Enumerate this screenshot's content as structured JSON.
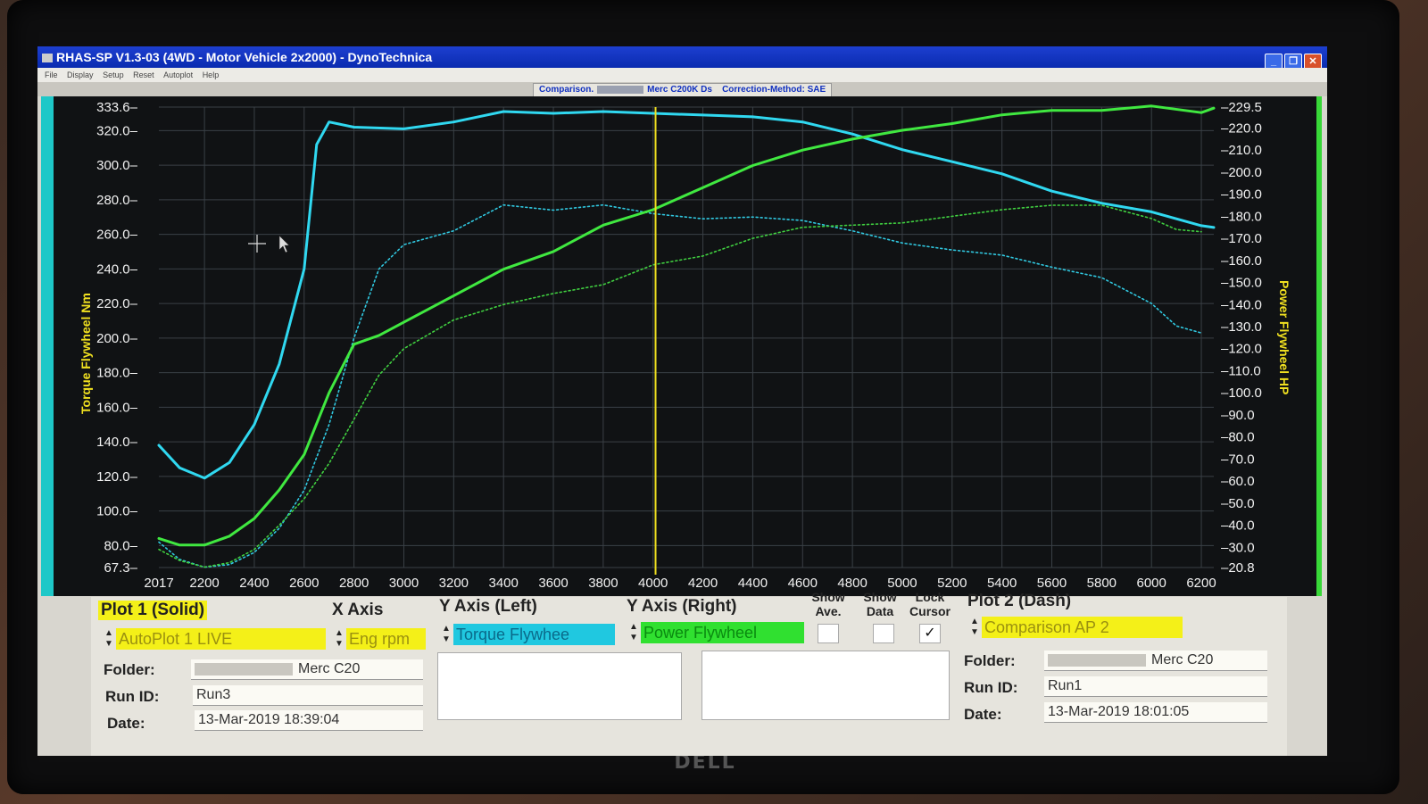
{
  "window": {
    "title": "RHAS-SP V1.3-03  (4WD - Motor Vehicle 2x2000) - DynoTechnica",
    "buttons": [
      "_",
      "❐",
      "✕"
    ]
  },
  "menu": [
    "File",
    "Display",
    "Setup",
    "Reset",
    "Autoplot",
    "Help"
  ],
  "info": {
    "comparison_label": "Comparison.",
    "vehicle": "Merc C200K Ds",
    "correction": "Correction-Method: SAE"
  },
  "axis_labels": {
    "left": "Torque Flywheel Nm",
    "right": "Power Flywheel HP"
  },
  "chart_data": {
    "type": "line",
    "xlabel": "",
    "x_ticks": [
      "2017",
      "2200",
      "2400",
      "2600",
      "2800",
      "3000",
      "3200",
      "3400",
      "3600",
      "3800",
      "4000",
      "4200",
      "4400",
      "4600",
      "4800",
      "5000",
      "5200",
      "5400",
      "5600",
      "5800",
      "6000",
      "6200"
    ],
    "xlim": [
      2017,
      6250
    ],
    "y_left": {
      "label": "Torque Flywheel Nm",
      "ticks": [
        "333.6",
        "320.0",
        "300.0",
        "280.0",
        "260.0",
        "240.0",
        "220.0",
        "200.0",
        "180.0",
        "160.0",
        "140.0",
        "120.0",
        "100.0",
        "80.0",
        "67.3"
      ],
      "range": [
        67.3,
        333.6
      ]
    },
    "y_right": {
      "label": "Power Flywheel HP",
      "ticks": [
        "229.5",
        "220.0",
        "210.0",
        "200.0",
        "190.0",
        "180.0",
        "170.0",
        "160.0",
        "150.0",
        "140.0",
        "130.0",
        "120.0",
        "110.0",
        "100.0",
        "90.0",
        "80.0",
        "70.0",
        "60.0",
        "50.0",
        "40.0",
        "30.0",
        "20.8"
      ],
      "range": [
        20.8,
        229.5
      ]
    },
    "cursor_x": 4010,
    "grid": true,
    "series": [
      {
        "name": "",
        "axis": "left",
        "style": "solid",
        "color": "#30d8f0",
        "x": [
          2017,
          2100,
          2200,
          2300,
          2400,
          2500,
          2600,
          2650,
          2700,
          2800,
          3000,
          3200,
          3400,
          3600,
          3800,
          4000,
          4200,
          4400,
          4600,
          4800,
          5000,
          5200,
          5400,
          5600,
          5800,
          6000,
          6200,
          6250
        ],
        "y": [
          138,
          125,
          119,
          128,
          150,
          185,
          240,
          312,
          325,
          322,
          321,
          325,
          331,
          330,
          331,
          330,
          329,
          328,
          325,
          318,
          309,
          302,
          295,
          285,
          278,
          273,
          265,
          264
        ]
      },
      {
        "name": "",
        "axis": "left",
        "style": "dotted",
        "color": "#30c8e0",
        "x": [
          2017,
          2100,
          2200,
          2300,
          2400,
          2500,
          2600,
          2700,
          2800,
          2900,
          3000,
          3200,
          3400,
          3600,
          3800,
          4000,
          4200,
          4400,
          4600,
          4800,
          5000,
          5200,
          5400,
          5600,
          5800,
          6000,
          6100,
          6200
        ],
        "y": [
          82,
          72,
          67.5,
          69,
          76,
          90,
          112,
          150,
          200,
          240,
          254,
          262,
          277,
          274,
          277,
          272,
          269,
          270,
          268,
          262,
          255,
          251,
          248,
          241,
          235,
          220,
          207,
          203
        ]
      },
      {
        "name": "",
        "axis": "right",
        "style": "solid",
        "color": "#40e840",
        "x": [
          2017,
          2100,
          2200,
          2300,
          2400,
          2500,
          2600,
          2700,
          2800,
          2900,
          3000,
          3200,
          3400,
          3600,
          3800,
          4000,
          4200,
          4400,
          4600,
          4800,
          5000,
          5200,
          5400,
          5600,
          5800,
          6000,
          6200,
          6250
        ],
        "y": [
          34,
          31,
          31,
          35,
          43,
          56,
          72,
          100,
          122,
          126,
          132,
          144,
          156,
          164,
          176,
          183,
          193,
          203,
          210,
          215,
          219,
          222,
          226,
          228,
          228,
          230,
          227,
          229
        ]
      },
      {
        "name": "",
        "axis": "right",
        "style": "dotted",
        "color": "#40d040",
        "x": [
          2017,
          2100,
          2200,
          2300,
          2400,
          2500,
          2600,
          2700,
          2800,
          2900,
          3000,
          3200,
          3400,
          3600,
          3800,
          4000,
          4200,
          4400,
          4600,
          4800,
          5000,
          5200,
          5400,
          5600,
          5800,
          6000,
          6100,
          6200
        ],
        "y": [
          29,
          24,
          21,
          23,
          29,
          40,
          52,
          68,
          88,
          108,
          120,
          133,
          140,
          145,
          149,
          158,
          162,
          170,
          175,
          176,
          177,
          180,
          183,
          185,
          185,
          179,
          174,
          173
        ]
      }
    ]
  },
  "panel": {
    "plot1_header": "Plot 1 (Solid)",
    "plot1_select": "AutoPlot 1 LIVE",
    "xaxis_header": "X Axis",
    "xaxis_select": "Eng rpm",
    "yleft_header": "Y Axis (Left)",
    "yleft_select": "Torque Flywhee",
    "yright_header": "Y Axis (Right)",
    "yright_select": "Power Flywheel",
    "show_ave": "Show\nAve.",
    "show_data": "Show\nData",
    "lock_cursor": "Lock\nCursor",
    "lock_checked_glyph": "✓",
    "plot2_header": "Plot 2 (Dash)",
    "plot2_select": "Comparison AP 2",
    "folder_label": "Folder:",
    "runid_label": "Run ID:",
    "date_label": "Date:",
    "plot1": {
      "folder": "Merc C20",
      "run_id": "Run3",
      "date": "13-Mar-2019  18:39:04"
    },
    "plot2": {
      "folder": "Merc C20",
      "run_id": "Run1",
      "date": "13-Mar-2019  18:01:05"
    }
  },
  "brand": "DELL"
}
